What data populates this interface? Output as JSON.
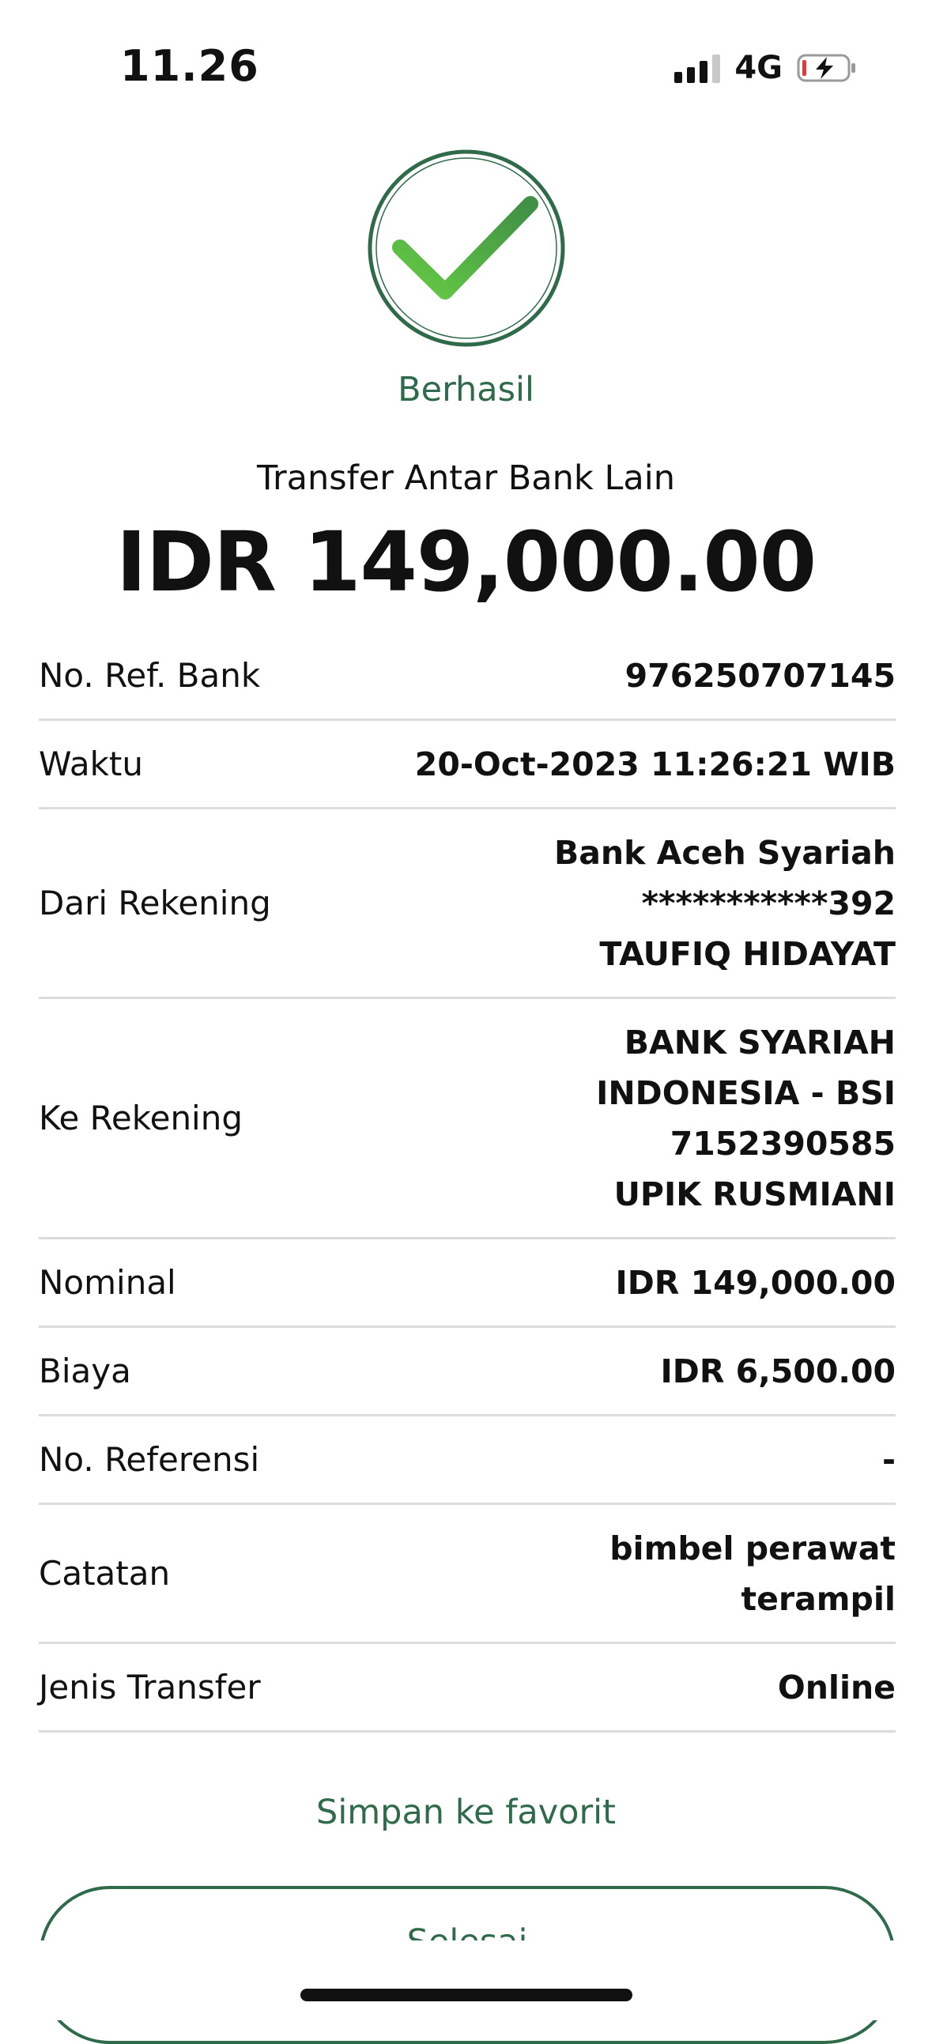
{
  "status_bar": {
    "time": "11.26",
    "network": "4G"
  },
  "status": {
    "label": "Berhasil",
    "icon": "checkmark-circle-icon",
    "accent_color": "#2f6b4a",
    "check_color": "#4caf50"
  },
  "transfer": {
    "type": "Transfer Antar Bank Lain",
    "amount": "IDR 149,000.00"
  },
  "details": [
    {
      "label": "No. Ref. Bank",
      "lines": [
        "976250707145"
      ]
    },
    {
      "label": "Waktu",
      "lines": [
        "20-Oct-2023 11:26:21 WIB"
      ]
    },
    {
      "label": "Dari Rekening",
      "lines": [
        "Bank Aceh Syariah",
        "***********392",
        "TAUFIQ HIDAYAT"
      ]
    },
    {
      "label": "Ke Rekening",
      "lines": [
        "BANK SYARIAH",
        "INDONESIA - BSI",
        "7152390585",
        "UPIK RUSMIANI"
      ]
    },
    {
      "label": "Nominal",
      "lines": [
        "IDR 149,000.00"
      ]
    },
    {
      "label": "Biaya",
      "lines": [
        "IDR 6,500.00"
      ]
    },
    {
      "label": "No. Referensi",
      "lines": [
        "-"
      ]
    },
    {
      "label": "Catatan",
      "lines": [
        "bimbel perawat",
        "terampil"
      ]
    },
    {
      "label": "Jenis Transfer",
      "lines": [
        "Online"
      ]
    }
  ],
  "actions": {
    "favorite_label": "Simpan ke favorit",
    "done_label": "Selesai"
  }
}
